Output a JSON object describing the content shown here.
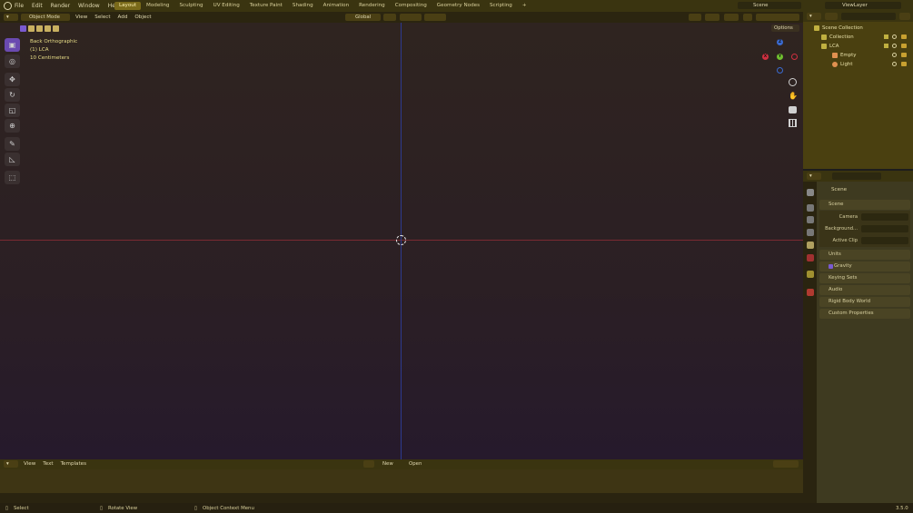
{
  "menu": [
    "File",
    "Edit",
    "Render",
    "Window",
    "Help"
  ],
  "workspace_tabs": [
    {
      "label": "Layout",
      "active": true
    },
    {
      "label": "Modeling"
    },
    {
      "label": "Sculpting"
    },
    {
      "label": "UV Editing"
    },
    {
      "label": "Texture Paint"
    },
    {
      "label": "Shading"
    },
    {
      "label": "Animation"
    },
    {
      "label": "Rendering"
    },
    {
      "label": "Compositing"
    },
    {
      "label": "Geometry Nodes"
    },
    {
      "label": "Scripting"
    }
  ],
  "add_workspace": "+",
  "scene": "Scene",
  "view_layer": "ViewLayer",
  "viewport_header": {
    "mode": "Object Mode",
    "menus": [
      "View",
      "Select",
      "Add",
      "Object"
    ],
    "transform_orientation": "Global",
    "options": "Options"
  },
  "viewport_info": {
    "view_name": "Back Orthographic",
    "collection": "(1) LCA",
    "scale": "10 Centimeters"
  },
  "gizmo": {
    "x": "X",
    "y": "Y",
    "z": "Z"
  },
  "outliner": {
    "root": "Scene Collection",
    "items": [
      {
        "label": "Collection"
      },
      {
        "label": "LCA"
      },
      {
        "label": "Empty"
      },
      {
        "label": "Light"
      }
    ]
  },
  "properties": {
    "context": "Scene",
    "panel_scene": "Scene",
    "camera_label": "Camera",
    "background_label": "Background...",
    "active_clip_label": "Active Clip",
    "panels": [
      "Units",
      "Gravity",
      "Keying Sets",
      "Audio",
      "Rigid Body World",
      "Custom Properties"
    ]
  },
  "text_editor": {
    "menus": [
      "View",
      "Text",
      "Templates"
    ],
    "new_label": "New",
    "open_label": "Open"
  },
  "statusbar": {
    "select": "Select",
    "rotate": "Rotate View",
    "context_menu": "Object Context Menu",
    "version": "3.5.0"
  }
}
